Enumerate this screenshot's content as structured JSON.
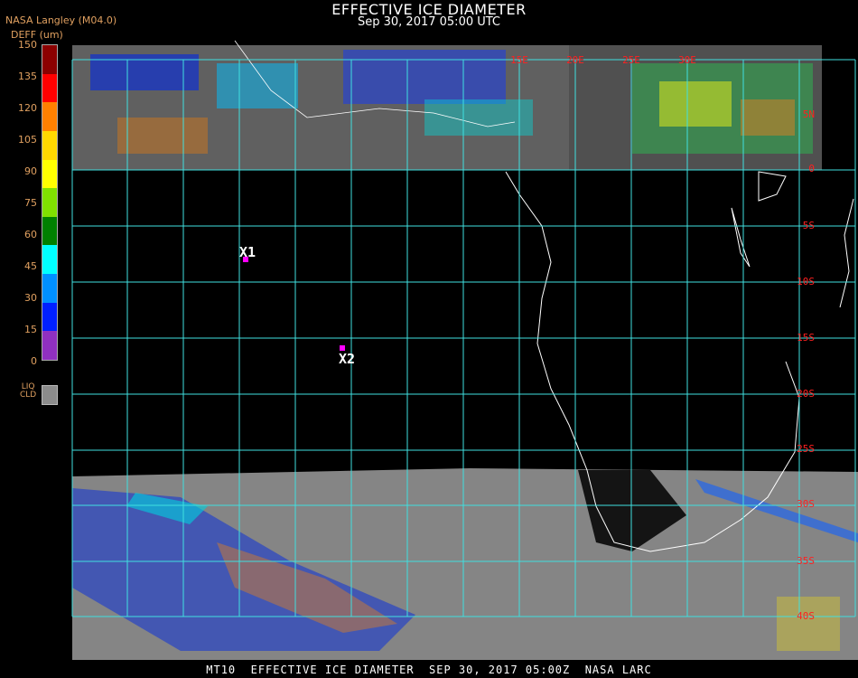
{
  "header": {
    "title": "EFFECTIVE ICE DIAMETER",
    "subtitle": "Sep 30, 2017 05:00 UTC",
    "source": "NASA Langley (M04.0)",
    "unit": "DEFF (um)"
  },
  "colorbar": {
    "ticks": [
      "150",
      "135",
      "120",
      "105",
      "90",
      "75",
      "60",
      "45",
      "30",
      "15",
      "0"
    ],
    "colors": [
      "#8b0000",
      "#ff0000",
      "#ff8000",
      "#ffd800",
      "#ffff00",
      "#80e000",
      "#008000",
      "#00ffff",
      "#0090ff",
      "#0020ff",
      "#9030c0"
    ],
    "liquid_label_line1": "LIQ",
    "liquid_label_line2": "CLD",
    "liquid_color": "#8c8c8c"
  },
  "map": {
    "lat_labels": [
      "5N",
      "0",
      "5S",
      "10S",
      "15S",
      "20S",
      "25S",
      "30S",
      "35S",
      "40S"
    ],
    "lon_labels": [
      "15E",
      "20E",
      "25E",
      "30E"
    ],
    "grid_color": "#40e0e0",
    "label_color": "#ff2020",
    "markers": [
      {
        "label": "X1",
        "color": "#ff00ff"
      },
      {
        "label": "X2",
        "color": "#ff00ff"
      }
    ]
  },
  "footer": "MT10  EFFECTIVE ICE DIAMETER  SEP 30, 2017 05:00Z  NASA LARC"
}
